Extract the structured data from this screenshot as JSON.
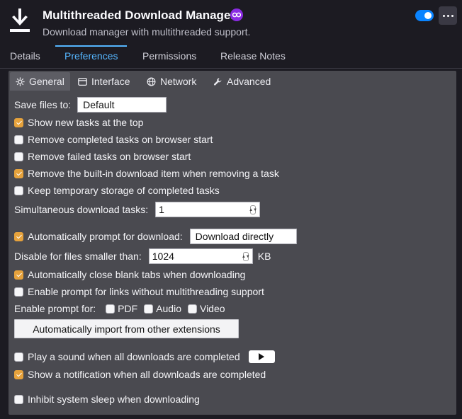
{
  "header": {
    "title": "Multithreaded Download Manager",
    "description": "Download manager with multithreaded support.",
    "enabled": true
  },
  "tabs": [
    {
      "label": "Details",
      "active": false
    },
    {
      "label": "Preferences",
      "active": true
    },
    {
      "label": "Permissions",
      "active": false
    },
    {
      "label": "Release Notes",
      "active": false
    }
  ],
  "subtabs": [
    {
      "label": "General",
      "icon": "gear-icon",
      "active": true
    },
    {
      "label": "Interface",
      "icon": "window-icon",
      "active": false
    },
    {
      "label": "Network",
      "icon": "globe-icon",
      "active": false
    },
    {
      "label": "Advanced",
      "icon": "wrench-icon",
      "active": false
    }
  ],
  "general": {
    "save_files_label": "Save files to:",
    "save_files_value": "Default",
    "options1": [
      {
        "label": "Show new tasks at the top",
        "checked": true
      },
      {
        "label": "Remove completed tasks on browser start",
        "checked": false
      },
      {
        "label": "Remove failed tasks on browser start",
        "checked": false
      },
      {
        "label": "Remove the built-in download item when removing a task",
        "checked": true
      },
      {
        "label": "Keep temporary storage of completed tasks",
        "checked": false
      }
    ],
    "simultaneous_label": "Simultaneous download tasks:",
    "simultaneous_value": "1",
    "auto_prompt_label": "Automatically prompt for download:",
    "auto_prompt_checked": true,
    "auto_prompt_value": "Download directly",
    "disable_smaller_label": "Disable for files smaller than:",
    "disable_smaller_value": "1024",
    "disable_smaller_unit": "KB",
    "options2": [
      {
        "label": "Automatically close blank tabs when downloading",
        "checked": true
      },
      {
        "label": "Enable prompt for links without multithreading support",
        "checked": false
      }
    ],
    "enable_prompt_for_label": "Enable prompt for:",
    "prompt_types": [
      {
        "label": "PDF",
        "checked": false
      },
      {
        "label": "Audio",
        "checked": false
      },
      {
        "label": "Video",
        "checked": false
      }
    ],
    "import_button": "Automatically import from other extensions",
    "play_sound_label": "Play a sound when all downloads are completed",
    "play_sound_checked": false,
    "notification_label": "Show a notification when all downloads are completed",
    "notification_checked": true,
    "inhibit_sleep_label": "Inhibit system sleep when downloading",
    "inhibit_sleep_checked": false
  },
  "colors": {
    "accent": "#55b6ff",
    "checkbox_checked": "#e6a23c",
    "panel": "#4a4a50",
    "background": "#1c1b22"
  }
}
